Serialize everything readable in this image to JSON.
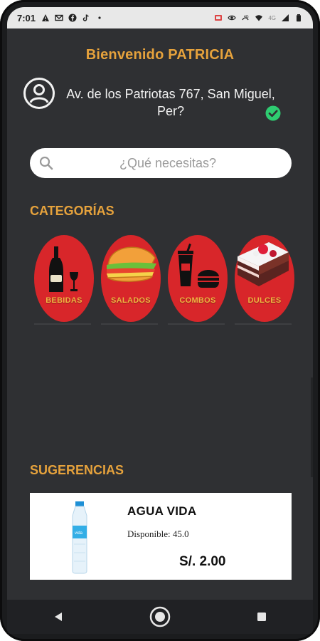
{
  "status_bar": {
    "time": "7:01",
    "left_icons": [
      "warning-icon",
      "gmail-icon",
      "facebook-icon",
      "tiktok-icon",
      "dot-icon"
    ],
    "right_icons": [
      "cast-icon",
      "eye-icon",
      "wifi-calling-icon",
      "wifi-icon",
      "signal-icon",
      "battery-icon"
    ],
    "network_label": "4G"
  },
  "header": {
    "welcome": "Bienvenido PATRICIA",
    "address": "Av. de los Patriotas 767, San Miguel, Per?"
  },
  "search": {
    "placeholder": "¿Qué necesitas?"
  },
  "categories": {
    "title": "CATEGORÍAS",
    "items": [
      {
        "label": "BEBIDAS",
        "icon": "wine-bottle-icon"
      },
      {
        "label": "SALADOS",
        "icon": "sandwich-icon"
      },
      {
        "label": "COMBOS",
        "icon": "combo-icon"
      },
      {
        "label": "DULCES",
        "icon": "cake-icon"
      }
    ]
  },
  "suggestions": {
    "title": "SUGERENCIAS",
    "products": [
      {
        "name": "AGUA VIDA",
        "availability": "Disponible: 45.0",
        "price": "S/. 2.00",
        "image": "water-bottle-image"
      }
    ]
  },
  "nav": {
    "buttons": [
      "back-button",
      "home-button",
      "recents-button"
    ]
  },
  "colors": {
    "accent": "#e6a23c",
    "background": "#2f3033",
    "category": "#d8262a",
    "check": "#2ecc71"
  }
}
